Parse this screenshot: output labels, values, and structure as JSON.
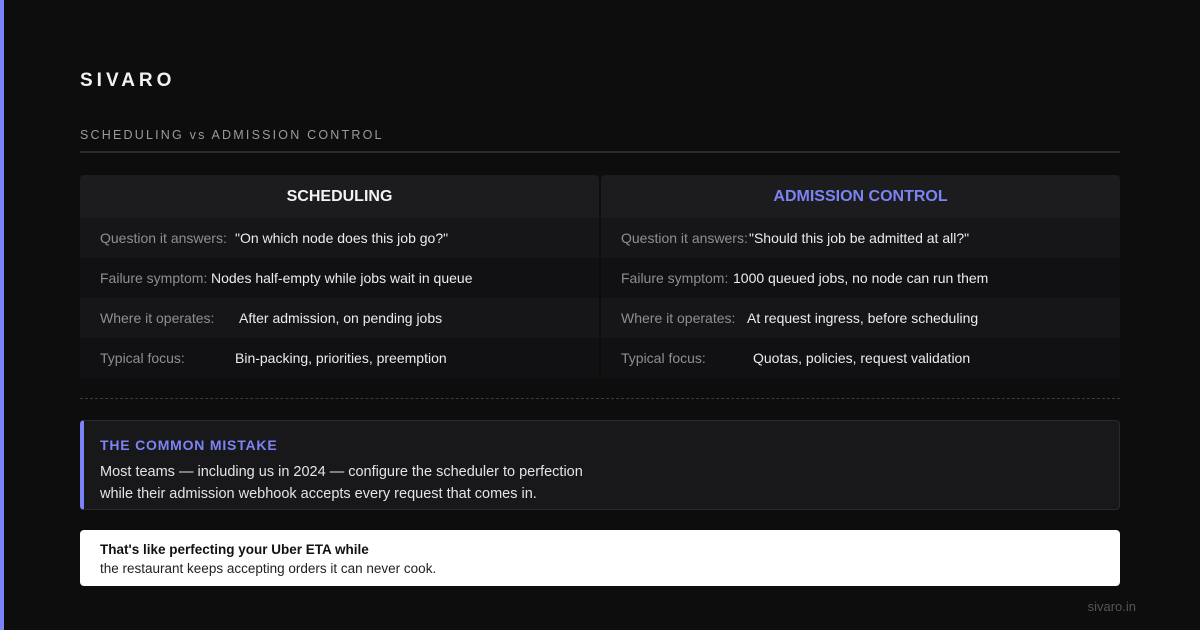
{
  "brand": "SIVARO",
  "section_label": "SCHEDULING vs ADMISSION CONTROL",
  "columns": [
    {
      "header": "SCHEDULING",
      "rows": [
        {
          "key": "Question it answers:",
          "value": "\"On which node does this job go?\""
        },
        {
          "key": "Failure symptom:",
          "value": "Nodes half-empty while jobs wait in queue"
        },
        {
          "key": "Where it operates:",
          "value": "After admission, on pending jobs"
        },
        {
          "key": "Typical focus:",
          "value": "Bin-packing, priorities, preemption"
        }
      ]
    },
    {
      "header": "ADMISSION CONTROL",
      "rows": [
        {
          "key": "Question it answers:",
          "value": "\"Should this job be admitted at all?\""
        },
        {
          "key": "Failure symptom:",
          "value": "1000 queued jobs, no node can run them"
        },
        {
          "key": "Where it operates:",
          "value": "At request ingress, before scheduling"
        },
        {
          "key": "Typical focus:",
          "value": "Quotas, policies, request validation"
        }
      ]
    }
  ],
  "mistake": {
    "title": "THE COMMON MISTAKE",
    "line1": "Most teams — including us in 2024 — configure the scheduler to perfection",
    "line2": "while their admission webhook accepts every request that comes in."
  },
  "analogy": {
    "strong": "That's like perfecting your Uber ETA while",
    "body": "the restaurant keeps accepting orders it can never cook."
  },
  "footer_url": "sivaro.in",
  "colors": {
    "accent": "#7c83f4",
    "background": "#0d0d0e"
  }
}
